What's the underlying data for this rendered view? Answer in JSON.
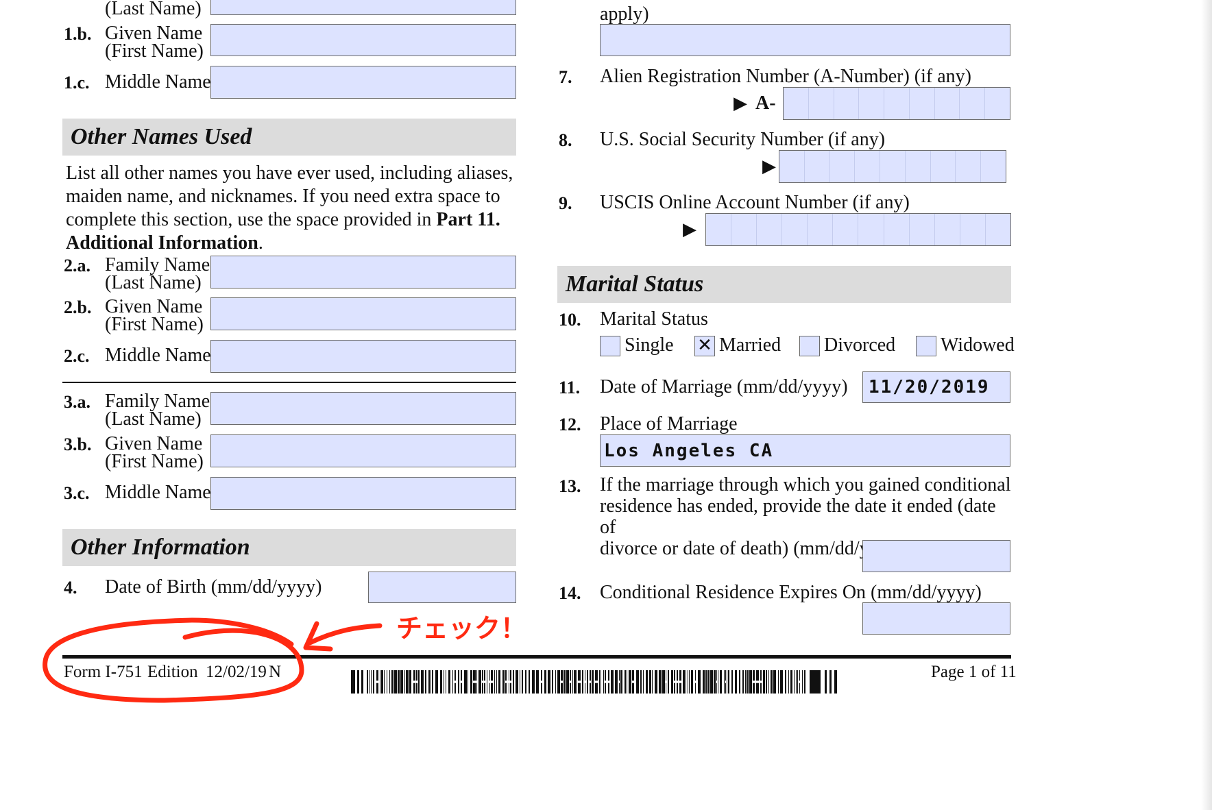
{
  "left": {
    "f1a_label": "(Last Name)",
    "f1b": {
      "num": "1.b.",
      "l1": "Given Name",
      "l2": "(First Name)"
    },
    "f1c": {
      "num": "1.c.",
      "l1": "Middle Name"
    },
    "other_names_header": "Other Names Used",
    "instructions": {
      "line1": "List all other names you have ever used, including aliases,",
      "line2": "maiden name, and nicknames.  If you need extra space to",
      "line3a": "complete this section, use the space provided in ",
      "line3b": "Part 11.",
      "line4a": "Additional Information",
      "line4b": "."
    },
    "f2a": {
      "num": "2.a.",
      "l1": "Family Name",
      "l2": "(Last Name)"
    },
    "f2b": {
      "num": "2.b.",
      "l1": "Given Name",
      "l2": "(First Name)"
    },
    "f2c": {
      "num": "2.c.",
      "l1": "Middle Name"
    },
    "f3a": {
      "num": "3.a.",
      "l1": "Family Name",
      "l2": "(Last Name)"
    },
    "f3b": {
      "num": "3.b.",
      "l1": "Given Name",
      "l2": "(First Name)"
    },
    "f3c": {
      "num": "3.c.",
      "l1": "Middle Name"
    },
    "other_info_header": "Other Information",
    "f4": {
      "num": "4.",
      "l1": "Date of Birth (mm/dd/yyyy)"
    }
  },
  "right": {
    "f6_tail": "apply)",
    "f7": {
      "num": "7.",
      "label": "Alien Registration Number (A-Number) (if any)",
      "prefix": "A-"
    },
    "f8": {
      "num": "8.",
      "label": "U.S. Social Security Number (if any)"
    },
    "f9": {
      "num": "9.",
      "label": "USCIS Online Account Number (if any)"
    },
    "marital_header": "Marital Status",
    "f10": {
      "num": "10.",
      "label": "Marital Status",
      "options": [
        {
          "label": "Single",
          "mark": ""
        },
        {
          "label": "Married",
          "mark": "✕"
        },
        {
          "label": "Divorced",
          "mark": ""
        },
        {
          "label": "Widowed",
          "mark": ""
        }
      ]
    },
    "f11": {
      "num": "11.",
      "label": "Date of Marriage (mm/dd/yyyy)",
      "value": "11/20/2019"
    },
    "f12": {
      "num": "12.",
      "label": "Place of Marriage",
      "value": "Los Angeles CA"
    },
    "f13": {
      "num": "13.",
      "l1": "If the marriage through which you gained conditional",
      "l2": "residence has ended, provide the date it ended (date of",
      "l3": "divorce or date of death) (mm/dd/yyyy)"
    },
    "f14": {
      "num": "14.",
      "label": "Conditional Residence Expires On (mm/dd/yyyy)"
    }
  },
  "footer": {
    "form": "Form I-751",
    "edition_label": "Edition",
    "edition_date": "12/02/19",
    "edition_code": "N",
    "page": "Page 1 of 11"
  },
  "annotation": {
    "text": "チェック！",
    "color": "#ff2a12"
  },
  "colors": {
    "field_fill": "#dde3ff",
    "header_fill": "#dcdcdc"
  }
}
